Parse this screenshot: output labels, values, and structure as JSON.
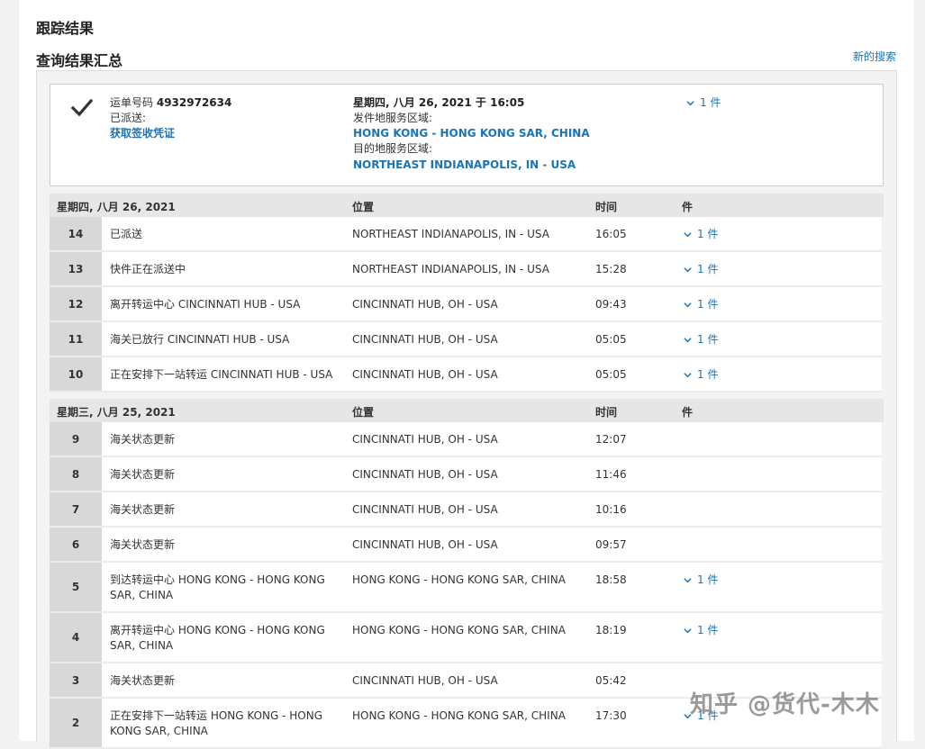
{
  "header": {
    "title": "跟踪结果",
    "subtitle": "查询结果汇总",
    "new_search": "新的搜索"
  },
  "summary": {
    "waybill_label": "运单号码",
    "waybill_number": "4932972634",
    "status": "已派送:",
    "pod_link": "获取签收凭证",
    "datetime": "星期四, 八月 26, 2021 于 16:05",
    "origin_label": "发件地服务区域:",
    "origin": "HONG KONG - HONG KONG SAR, CHINA",
    "dest_label": "目的地服务区域:",
    "dest": "NORTHEAST INDIANAPOLIS, IN - USA",
    "pieces": "1 件"
  },
  "columns": {
    "location": "位置",
    "time": "时间",
    "pieces": "件"
  },
  "days": [
    {
      "date": "星期四, 八月 26, 2021"
    },
    {
      "date": "星期三, 八月 25, 2021"
    }
  ],
  "events": [
    {
      "num": "14",
      "desc": "已派送",
      "loc": "NORTHEAST INDIANAPOLIS, IN - USA",
      "time": "16:05",
      "pieces": "1 件"
    },
    {
      "num": "13",
      "desc": "快件正在派送中",
      "loc": "NORTHEAST INDIANAPOLIS, IN - USA",
      "time": "15:28",
      "pieces": "1 件"
    },
    {
      "num": "12",
      "desc": "离开转运中心 CINCINNATI HUB - USA",
      "loc": "CINCINNATI HUB, OH - USA",
      "time": "09:43",
      "pieces": "1 件"
    },
    {
      "num": "11",
      "desc": "海关已放行 CINCINNATI HUB - USA",
      "loc": "CINCINNATI HUB, OH - USA",
      "time": "05:05",
      "pieces": "1 件"
    },
    {
      "num": "10",
      "desc": "正在安排下一站转运 CINCINNATI HUB - USA",
      "loc": "CINCINNATI HUB, OH - USA",
      "time": "05:05",
      "pieces": "1 件"
    },
    {
      "num": "9",
      "desc": "海关状态更新",
      "loc": "CINCINNATI HUB, OH - USA",
      "time": "12:07",
      "pieces": ""
    },
    {
      "num": "8",
      "desc": "海关状态更新",
      "loc": "CINCINNATI HUB, OH - USA",
      "time": "11:46",
      "pieces": ""
    },
    {
      "num": "7",
      "desc": "海关状态更新",
      "loc": "CINCINNATI HUB, OH - USA",
      "time": "10:16",
      "pieces": ""
    },
    {
      "num": "6",
      "desc": "海关状态更新",
      "loc": "CINCINNATI HUB, OH - USA",
      "time": "09:57",
      "pieces": ""
    },
    {
      "num": "5",
      "desc": "到达转运中心 HONG KONG - HONG KONG SAR, CHINA",
      "loc": "HONG KONG - HONG KONG SAR, CHINA",
      "time": "18:58",
      "pieces": "1 件"
    },
    {
      "num": "4",
      "desc": "离开转运中心 HONG KONG - HONG KONG SAR, CHINA",
      "loc": "HONG KONG - HONG KONG SAR, CHINA",
      "time": "18:19",
      "pieces": "1 件"
    },
    {
      "num": "3",
      "desc": "海关状态更新",
      "loc": "CINCINNATI HUB, OH - USA",
      "time": "05:42",
      "pieces": ""
    },
    {
      "num": "2",
      "desc": "正在安排下一站转运 HONG KONG - HONG KONG SAR, CHINA",
      "loc": "HONG KONG - HONG KONG SAR, CHINA",
      "time": "17:30",
      "pieces": "1 件"
    }
  ],
  "watermark": "知乎 @货代-木木",
  "colors": {
    "link": "#1a74b5",
    "index_cell": "#d8d8d8",
    "day_header": "#e6e6e6"
  }
}
